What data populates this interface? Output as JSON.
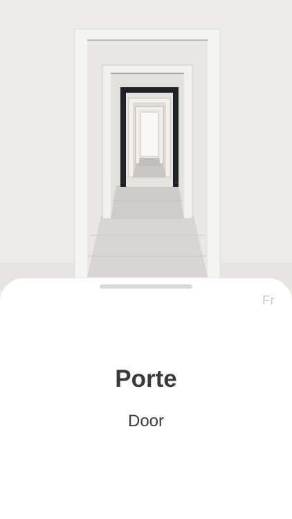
{
  "card": {
    "language_tag": "Fr",
    "word": "Porte",
    "translation": "Door"
  },
  "image": {
    "subject": "nested-doorways-photo"
  },
  "colors": {
    "background": "#ececea",
    "card": "#ffffff",
    "word_text": "#3a3a3a",
    "tag_text": "#c9c9c9",
    "handle": "#d8d8d8"
  }
}
